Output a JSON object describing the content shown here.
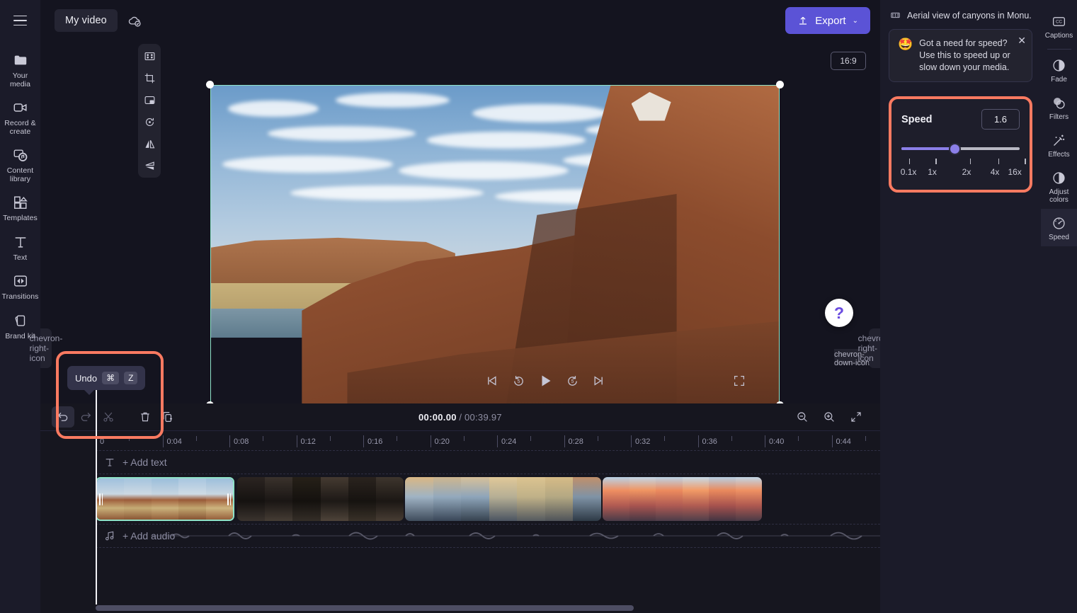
{
  "app": {
    "project_title": "My video",
    "cloud_status_icon": "cloud-check-icon",
    "export_label": "Export",
    "export_caret": "⌄"
  },
  "left_rail": {
    "menu_icon": "hamburger-icon",
    "items": [
      {
        "label": "Your media",
        "icon": "media-folder-icon"
      },
      {
        "label": "Record & create",
        "icon": "video-camera-icon"
      },
      {
        "label": "Content library",
        "icon": "content-library-icon"
      },
      {
        "label": "Templates",
        "icon": "templates-icon"
      },
      {
        "label": "Text",
        "icon": "text-icon"
      },
      {
        "label": "Transitions",
        "icon": "transitions-icon"
      },
      {
        "label": "Brand kit",
        "icon": "brand-kit-icon"
      }
    ]
  },
  "preview": {
    "aspect_ratio": "16:9",
    "edit_tools": [
      {
        "icon": "fit-to-screen-icon"
      },
      {
        "icon": "crop-icon"
      },
      {
        "icon": "picture-in-picture-icon"
      },
      {
        "icon": "rotate-icon"
      },
      {
        "icon": "flip-horizontal-icon"
      },
      {
        "icon": "flip-vertical-icon"
      }
    ],
    "playback": [
      {
        "icon": "skip-to-start-icon"
      },
      {
        "icon": "rewind-5-icon"
      },
      {
        "icon": "play-icon"
      },
      {
        "icon": "forward-5-icon"
      },
      {
        "icon": "skip-to-end-icon"
      }
    ],
    "fullscreen_icon": "fullscreen-icon",
    "help_label": "?",
    "collapse_icon": "chevron-down-icon",
    "panel_collapse_icon": "chevron-right-icon",
    "sidebar_collapse_icon": "chevron-right-icon"
  },
  "timeline": {
    "toolbar": [
      {
        "icon": "undo-icon",
        "state": "active"
      },
      {
        "icon": "redo-icon",
        "state": "disabled"
      },
      {
        "icon": "split-scissors-icon",
        "state": "disabled"
      },
      {
        "icon": "delete-trash-icon",
        "state": "normal"
      },
      {
        "icon": "duplicate-icon",
        "state": "normal"
      }
    ],
    "current_time": "00:00.00",
    "separator": "/",
    "total_time": "00:39.97",
    "zoom_out_icon": "zoom-out-icon",
    "zoom_in_icon": "zoom-in-icon",
    "fit_icon": "fit-timeline-icon",
    "ruler_labels": [
      "0",
      "0:04",
      "0:08",
      "0:12",
      "0:16",
      "0:20",
      "0:24",
      "0:28",
      "0:32",
      "0:36",
      "0:40",
      "0:44",
      "0"
    ],
    "add_text_label": "+ Add text",
    "add_text_icon": "text-icon",
    "add_audio_label": "+ Add audio",
    "add_audio_icon": "music-note-icon",
    "clips": [
      {
        "name": "canyon-clip",
        "selected": true
      },
      {
        "name": "dark-rock-clip",
        "selected": false
      },
      {
        "name": "mountain-clouds-clip",
        "selected": false
      },
      {
        "name": "sunset-peaks-clip",
        "selected": false
      }
    ]
  },
  "undo_tooltip": {
    "label": "Undo",
    "key_modifier": "⌘",
    "key_letter": "Z"
  },
  "right_panel": {
    "clip_title": "Aerial view of canyons in Monu...",
    "clip_icon": "filmstrip-icon",
    "tip": {
      "emoji": "🤩",
      "text": "Got a need for speed? Use this to speed up or slow down your media.",
      "close_icon": "close-icon"
    },
    "speed": {
      "label": "Speed",
      "value": "1.6",
      "ticks": [
        "0.1x",
        "1x",
        "2x",
        "4x",
        "16x"
      ],
      "fill_color": "#8b7fe8",
      "highlight_color": "#fa7a61"
    }
  },
  "right_rail": {
    "items": [
      {
        "label": "Captions",
        "icon": "closed-captions-icon",
        "active": false
      },
      {
        "label": "Fade",
        "icon": "fade-icon",
        "active": false
      },
      {
        "label": "Filters",
        "icon": "filters-icon",
        "active": false
      },
      {
        "label": "Effects",
        "icon": "effects-wand-icon",
        "active": false
      },
      {
        "label": "Adjust colors",
        "icon": "adjust-colors-icon",
        "active": false
      },
      {
        "label": "Speed",
        "icon": "speedometer-icon",
        "active": true
      }
    ]
  }
}
